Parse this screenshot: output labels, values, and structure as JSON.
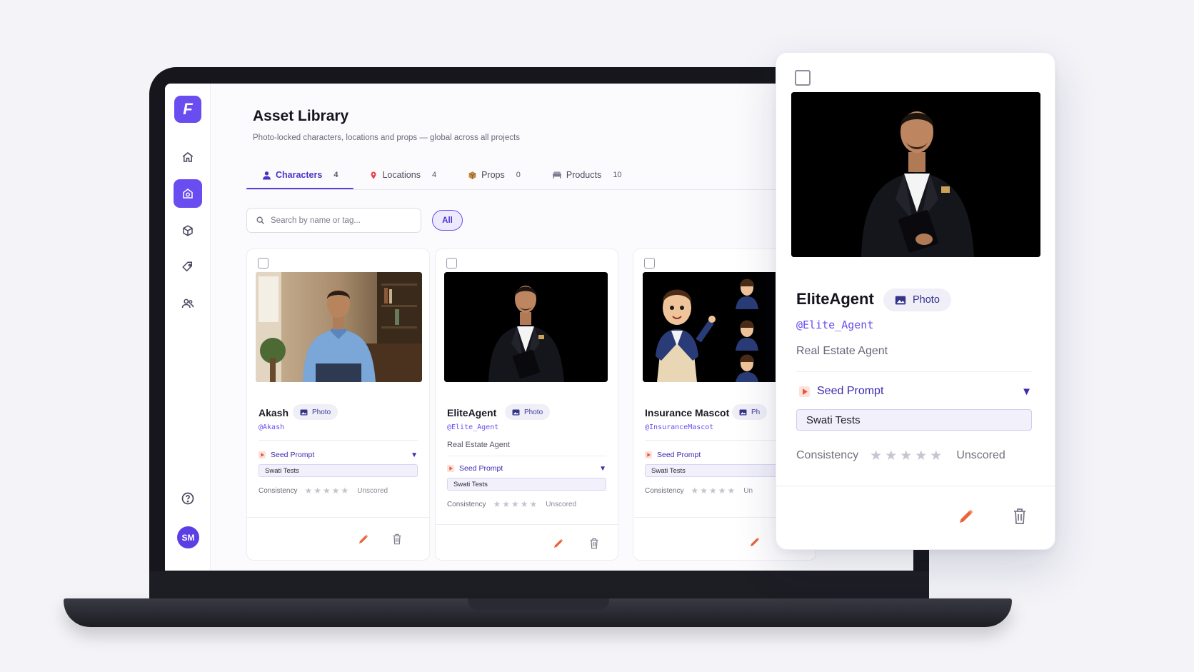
{
  "app": {
    "logo_letter": "F",
    "user_initials": "SM"
  },
  "page": {
    "title": "Asset Library",
    "subtitle": "Photo-locked characters, locations and props — global across all projects"
  },
  "tabs": [
    {
      "label": "Characters",
      "count": "4",
      "icon": "person-icon"
    },
    {
      "label": "Locations",
      "count": "4",
      "icon": "pin-icon"
    },
    {
      "label": "Props",
      "count": "0",
      "icon": "box-icon"
    },
    {
      "label": "Products",
      "count": "10",
      "icon": "sofa-icon"
    }
  ],
  "search": {
    "placeholder": "Search by name or tag..."
  },
  "filter": {
    "all_label": "All"
  },
  "cards": [
    {
      "name": "Akash",
      "badge": "Photo",
      "handle": "@Akash",
      "role": "",
      "seed_label": "Seed Prompt",
      "seed_value": "Swati Tests",
      "consistency_label": "Consistency",
      "score_label": "Unscored"
    },
    {
      "name": "EliteAgent",
      "badge": "Photo",
      "handle": "@Elite_Agent",
      "role": "Real Estate Agent",
      "seed_label": "Seed Prompt",
      "seed_value": "Swati Tests",
      "consistency_label": "Consistency",
      "score_label": "Unscored"
    },
    {
      "name": "Insurance Mascot",
      "badge": "Ph",
      "handle": "@InsuranceMascot",
      "role": "",
      "seed_label": "Seed Prompt",
      "seed_value": "Swati Tests",
      "consistency_label": "Consistency",
      "score_label": "Un"
    }
  ],
  "detail": {
    "name": "EliteAgent",
    "badge": "Photo",
    "handle": "@Elite_Agent",
    "role": "Real Estate Agent",
    "seed_label": "Seed Prompt",
    "seed_value": "Swati Tests",
    "consistency_label": "Consistency",
    "score_label": "Unscored"
  },
  "colors": {
    "accent": "#6a4df0",
    "edit": "#e8643c",
    "delete": "#8a8a98"
  }
}
